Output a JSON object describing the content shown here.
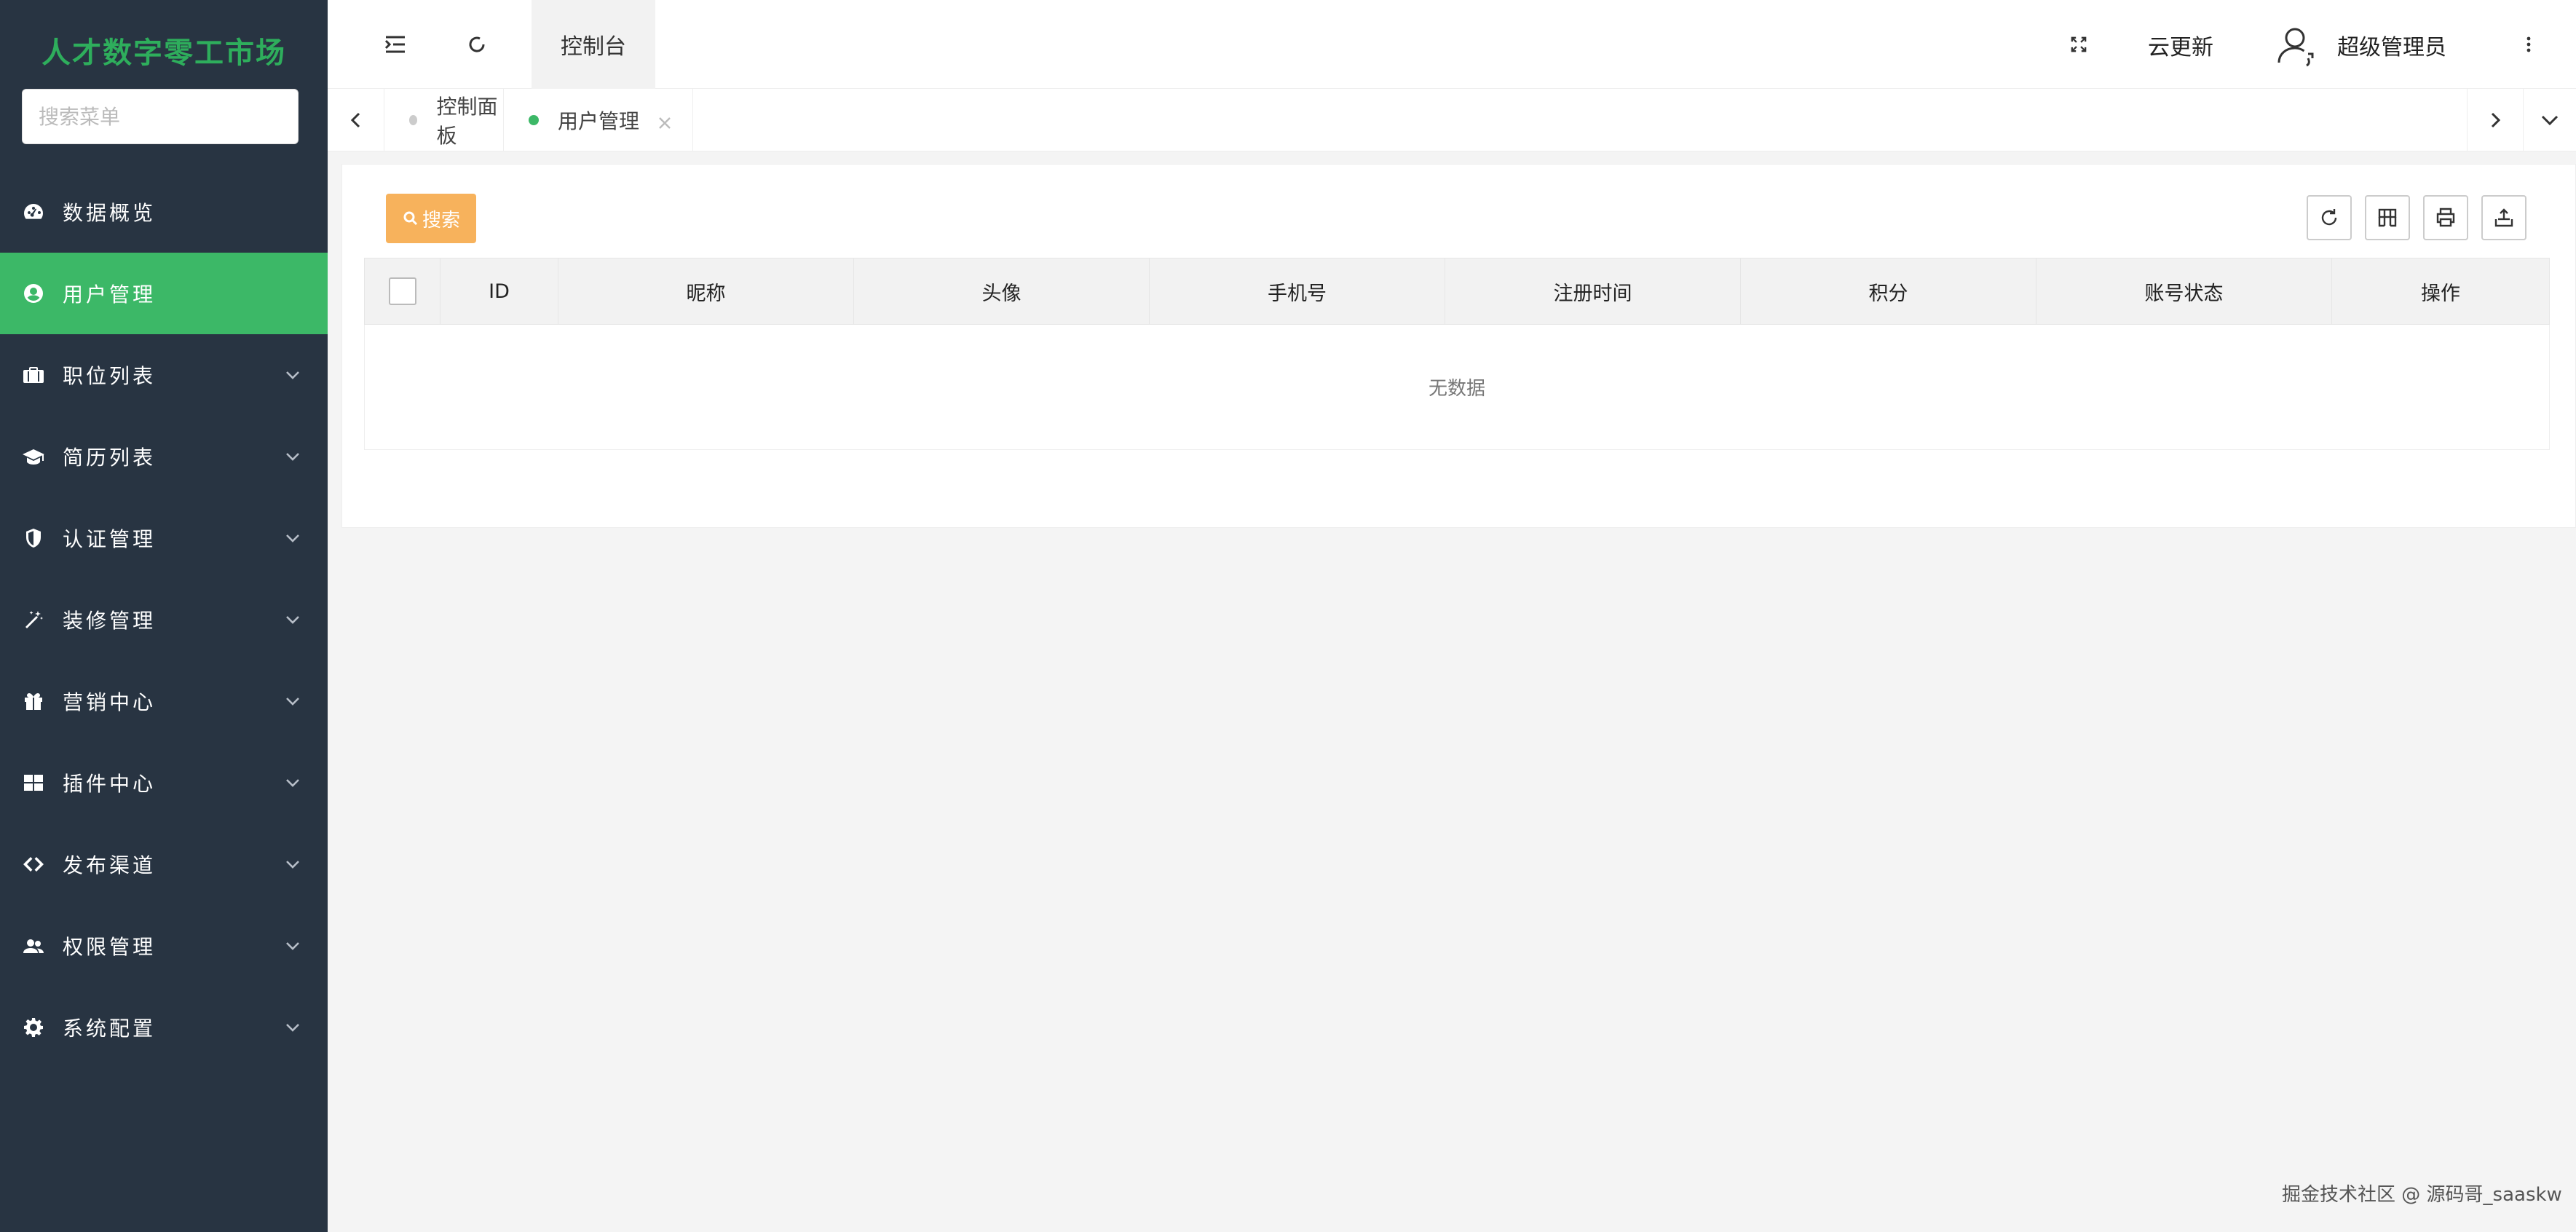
{
  "sidebar": {
    "logo": "人才数字零工市场",
    "search_placeholder": "搜索菜单",
    "items": [
      {
        "label": "数据概览",
        "icon": "dashboard-icon",
        "active": false,
        "expandable": false
      },
      {
        "label": "用户管理",
        "icon": "user-circle-icon",
        "active": true,
        "expandable": false
      },
      {
        "label": "职位列表",
        "icon": "briefcase-icon",
        "active": false,
        "expandable": true
      },
      {
        "label": "简历列表",
        "icon": "graduation-cap-icon",
        "active": false,
        "expandable": true
      },
      {
        "label": "认证管理",
        "icon": "shield-icon",
        "active": false,
        "expandable": true
      },
      {
        "label": "装修管理",
        "icon": "magic-wand-icon",
        "active": false,
        "expandable": true
      },
      {
        "label": "营销中心",
        "icon": "gift-icon",
        "active": false,
        "expandable": true
      },
      {
        "label": "插件中心",
        "icon": "grid-icon",
        "active": false,
        "expandable": true
      },
      {
        "label": "发布渠道",
        "icon": "diamond-icon",
        "active": false,
        "expandable": true
      },
      {
        "label": "权限管理",
        "icon": "users-icon",
        "active": false,
        "expandable": true
      },
      {
        "label": "系统配置",
        "icon": "gear-icon",
        "active": false,
        "expandable": true
      }
    ]
  },
  "header": {
    "tab": "控制台",
    "cloud_update": "云更新",
    "user_name": "超级管理员"
  },
  "tabs": [
    {
      "label": "控制面板",
      "active": false,
      "dot_color": "#cccccc"
    },
    {
      "label": "用户管理",
      "active": true,
      "dot_color": "#3cb867"
    }
  ],
  "toolbar": {
    "search_label": "搜索"
  },
  "table": {
    "columns": [
      "ID",
      "昵称",
      "头像",
      "手机号",
      "注册时间",
      "积分",
      "账号状态",
      "操作"
    ],
    "empty_text": "无数据"
  },
  "watermark": "掘金技术社区 @ 源码哥_saaskw",
  "colors": {
    "sidebar_bg": "#283442",
    "accent": "#3cb867",
    "logo": "#2eae5c",
    "search_button": "#f7b25c"
  }
}
